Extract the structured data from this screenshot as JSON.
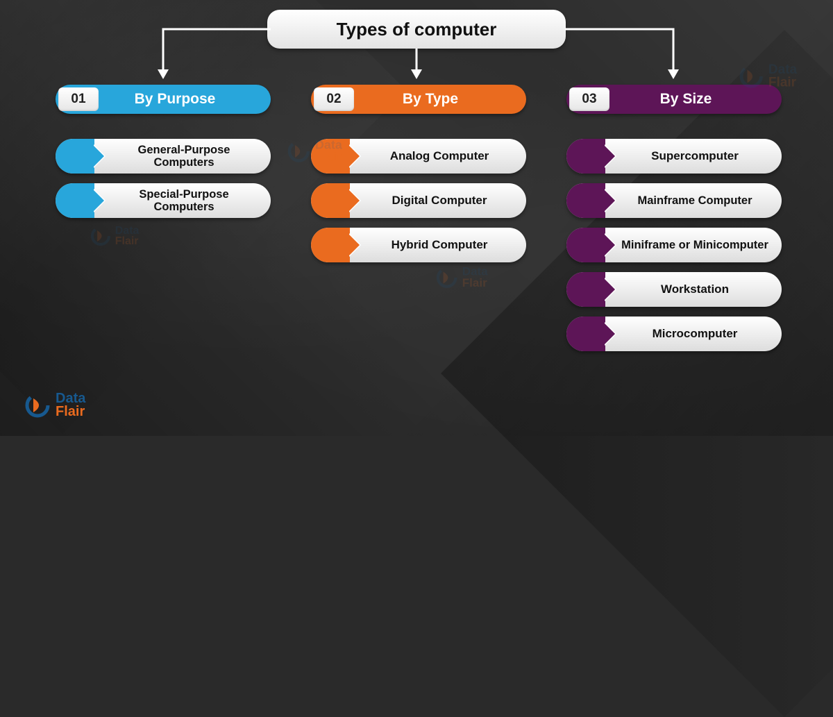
{
  "title": "Types of computer",
  "brand": {
    "word1": "Data",
    "word2": "Flair"
  },
  "colors": {
    "blue": "#28a6db",
    "orange": "#ea6b1f",
    "purple": "#5d1557"
  },
  "categories": [
    {
      "num": "01",
      "label": "By Purpose",
      "color": "blue",
      "items": [
        "General-Purpose Computers",
        "Special-Purpose Computers"
      ]
    },
    {
      "num": "02",
      "label": "By Type",
      "color": "orange",
      "items": [
        "Analog Computer",
        "Digital Computer",
        "Hybrid Computer"
      ]
    },
    {
      "num": "03",
      "label": "By Size",
      "color": "purple",
      "items": [
        "Supercomputer",
        "Mainframe Computer",
        "Miniframe or Minicomputer",
        "Workstation",
        "Microcomputer"
      ]
    }
  ]
}
